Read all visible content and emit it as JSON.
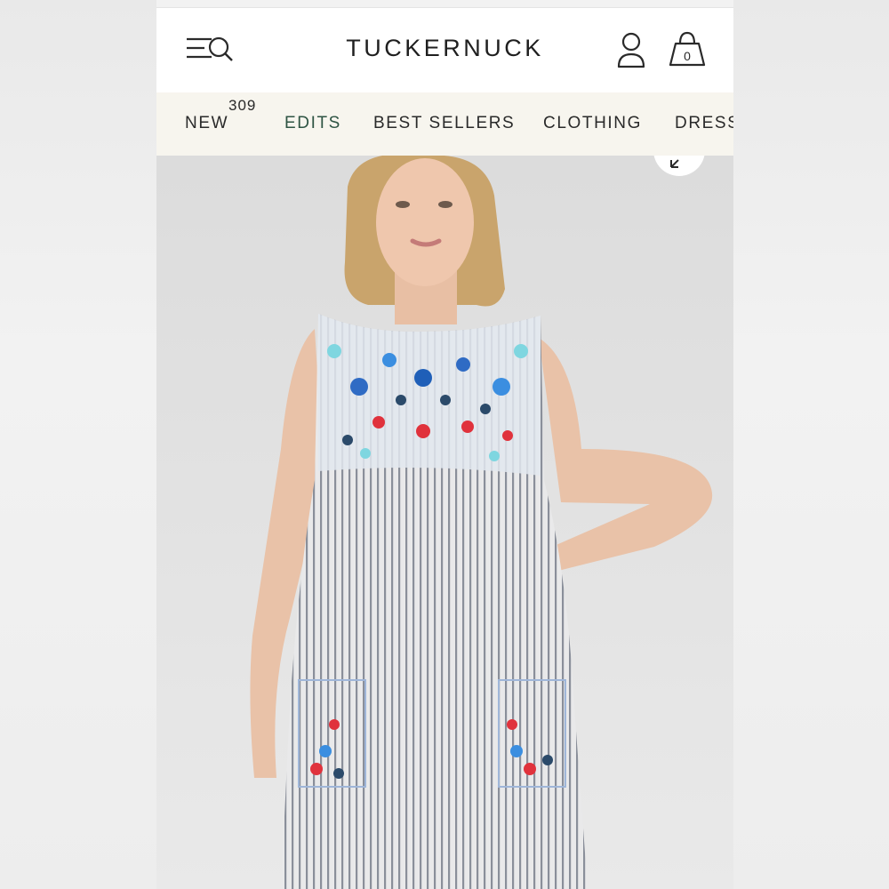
{
  "header": {
    "logo": "TUCKERNUCK",
    "bag_count": "0"
  },
  "nav": {
    "badge": "309",
    "items": [
      {
        "label": "NEW"
      },
      {
        "label": "EDITS"
      },
      {
        "label": "BEST SELLERS"
      },
      {
        "label": "CLOTHING"
      },
      {
        "label": "DRESS"
      }
    ]
  },
  "icons": {
    "menu": "menu-search-icon",
    "account": "user-icon",
    "bag": "shopping-bag-icon",
    "expand": "expand-icon"
  },
  "colors": {
    "nav_bg": "#f7f5ee",
    "edits_accent": "#2e5443",
    "text": "#1f1f1f"
  }
}
